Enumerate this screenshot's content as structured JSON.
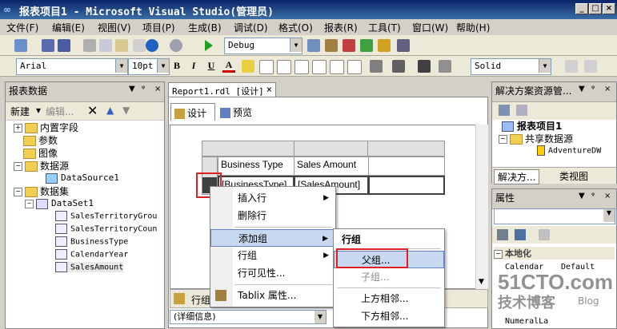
{
  "window": {
    "title": "报表项目1 - Microsoft Visual Studio(管理员)",
    "min": "_",
    "max": "□",
    "close": "×"
  },
  "menu": [
    "文件(F)",
    "编辑(E)",
    "视图(V)",
    "项目(P)",
    "生成(B)",
    "调试(D)",
    "格式(O)",
    "报表(R)",
    "工具(T)",
    "窗口(W)",
    "帮助(H)"
  ],
  "toolbar": {
    "config": "Debug",
    "font": "Arial",
    "size": "10pt",
    "bold": "B",
    "italic": "I",
    "underline": "U",
    "font_color": "A",
    "border": "Solid"
  },
  "report_data": {
    "title": "报表数据",
    "new": "新建",
    "edit": "编辑...",
    "tree": {
      "builtin": "内置字段",
      "params": "参数",
      "images": "图像",
      "datasources": "数据源",
      "datasource1": "DataSource1",
      "datasets": "数据集",
      "dataset1": "DataSet1",
      "fields": [
        "SalesTerritoryGrou",
        "SalesTerritoryCoun",
        "BusinessType",
        "CalendarYear",
        "SalesAmount"
      ]
    }
  },
  "document": {
    "tab": "Report1.rdl [设计]",
    "design_tab": "设计",
    "preview_tab": "预览",
    "header_cells": [
      "Business Type",
      "Sales Amount",
      ""
    ],
    "data_cells": [
      "[BusinessType]",
      "[SalesAmount]",
      ""
    ],
    "row_group_label": "行组",
    "detail_combo": "(详细信息)"
  },
  "context_menu": {
    "items": [
      "插入行",
      "删除行",
      "添加组",
      "行组",
      "行可见性...",
      "Tablix 属性..."
    ]
  },
  "submenu": {
    "header": "行组",
    "items": [
      "父组...",
      "子组...",
      "上方相邻...",
      "下方相邻..."
    ]
  },
  "solution_explorer": {
    "title": "解决方案资源管...",
    "project": "报表项目1",
    "shared_ds": "共享数据源",
    "adventure": "AdventureDW",
    "tab1": "解决方...",
    "tab2": "类视图"
  },
  "properties": {
    "title": "属性",
    "category": "本地化",
    "row1": "Calendar",
    "row1_value": "Default",
    "row_last": "NumeralLa"
  },
  "watermark": {
    "main": "51CTO.com",
    "sub": "技术博客",
    "blog": "Blog"
  }
}
